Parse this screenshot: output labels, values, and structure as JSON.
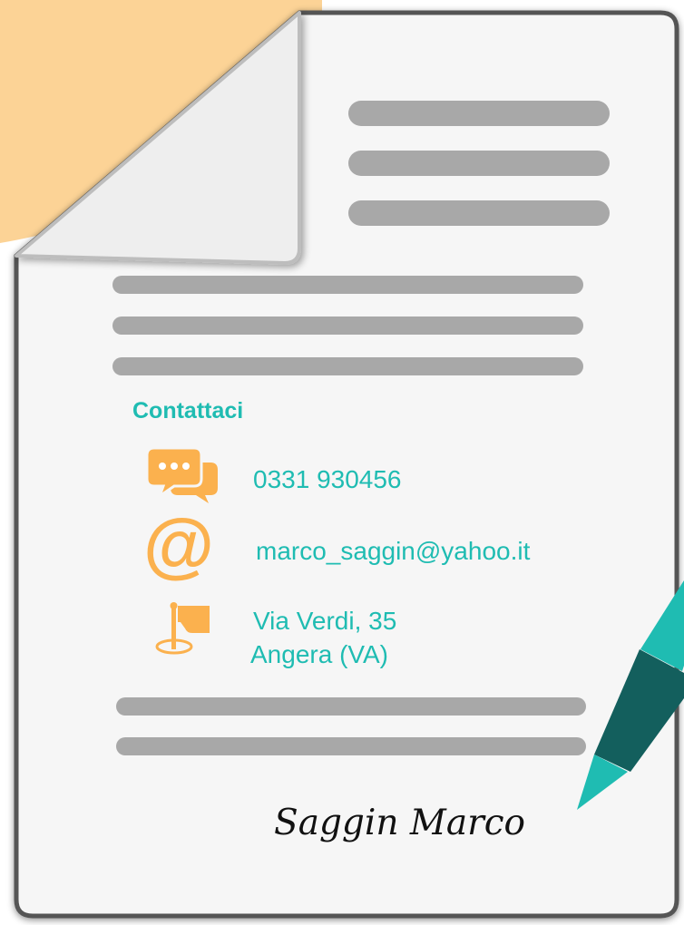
{
  "theme": {
    "accent": "#1fbcb2",
    "icon_color": "#fbb14e",
    "corner_color": "#fcd396",
    "page_color": "#f6f6f6",
    "line_color": "#a8a8a8",
    "pen_dark": "#135f5d",
    "pen_light": "#1fbcb2"
  },
  "contact": {
    "heading": "Contattaci",
    "phone": "0331 930456",
    "email": "marco_saggin@yahoo.it",
    "address_line1": "Via Verdi, 35",
    "address_line2": "Angera (VA)"
  },
  "icons": {
    "phone": "chat-bubbles-icon",
    "email": "at-sign-icon",
    "address": "location-flag-icon"
  },
  "signature": {
    "text": "Saggin Marco"
  }
}
